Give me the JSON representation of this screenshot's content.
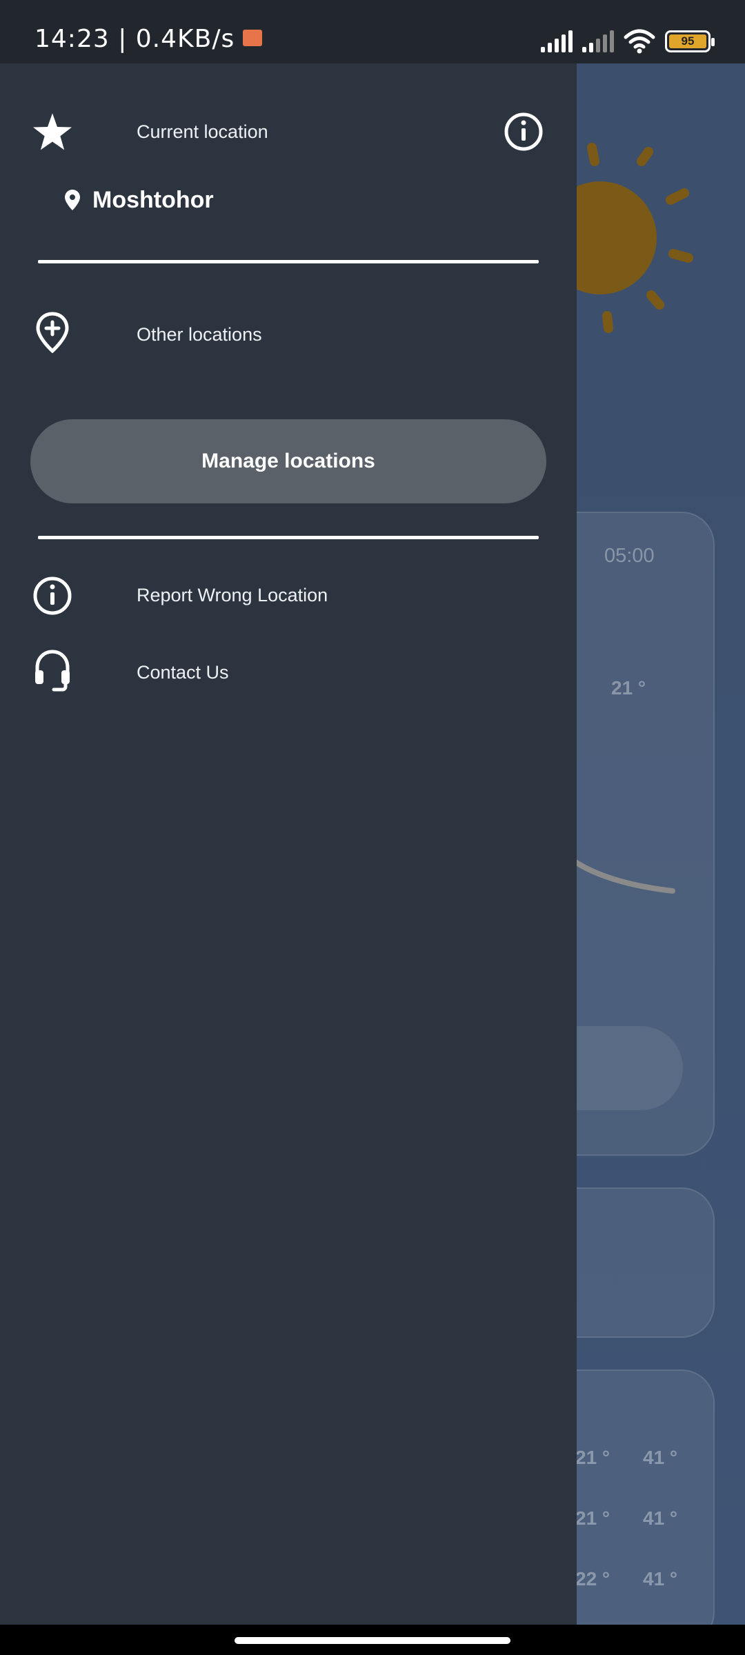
{
  "status_bar": {
    "time_speed": "14:23 | 0.4KB/s",
    "battery": "95"
  },
  "drawer": {
    "current_location_label": "Current location",
    "location_name": "Moshtohor",
    "other_locations_label": "Other locations",
    "manage_locations_label": "Manage locations",
    "report_wrong_location_label": "Report Wrong Location",
    "contact_us_label": "Contact Us"
  },
  "background": {
    "hour_time": "05:00",
    "hour_temp": "21 °",
    "forecast": [
      {
        "low": "21 °",
        "high": "41 °"
      },
      {
        "low": "21 °",
        "high": "41 °"
      },
      {
        "low": "22 °",
        "high": "41 °"
      }
    ],
    "sun_color": "#e08a00"
  },
  "colors": {
    "drawer_bg": "#2c353f",
    "button_bg": "#5a6169",
    "status_bar_bg": "#22272e",
    "app_bg": "#3c4f6c"
  }
}
